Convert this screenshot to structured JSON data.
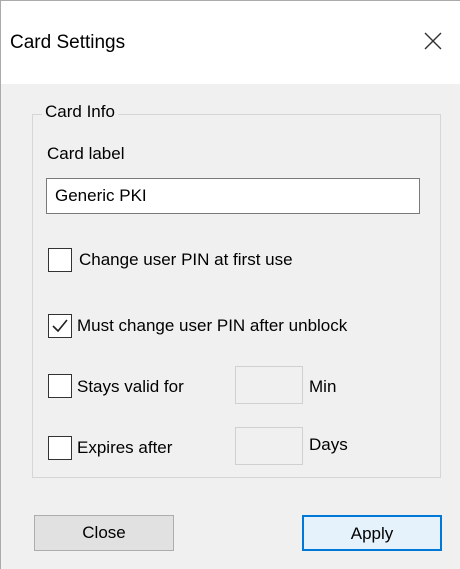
{
  "window": {
    "title": "Card Settings",
    "close_icon": "close-icon"
  },
  "card_info": {
    "group_label": "Card Info",
    "card_label_caption": "Card label",
    "card_label_value": "Generic PKI"
  },
  "options": {
    "change_pin_first_use": {
      "label": "Change user PIN at first use",
      "checked": false
    },
    "must_change_after_unblock": {
      "label": "Must change user PIN after unblock",
      "checked": true
    },
    "stays_valid": {
      "label": "Stays valid for",
      "checked": false,
      "unit": "Min",
      "value": ""
    },
    "expires_after": {
      "label": "Expires after",
      "checked": false,
      "unit": "Days",
      "value": ""
    }
  },
  "buttons": {
    "close_label": "Close",
    "apply_label": "Apply"
  },
  "colors": {
    "accent": "#0078d7",
    "dialog_bg": "#f0f0f0"
  }
}
